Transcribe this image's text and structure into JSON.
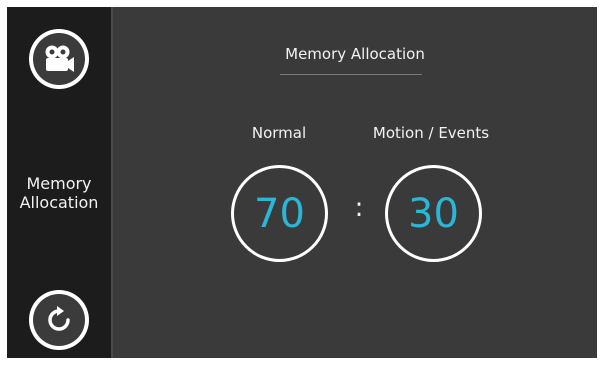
{
  "sidebar": {
    "camera_icon": "video-camera-icon",
    "reset_icon": "refresh-icon",
    "label_line1": "Memory",
    "label_line2": "Allocation"
  },
  "main": {
    "title": "Memory Allocation",
    "normal_label": "Normal",
    "events_label": "Motion / Events",
    "normal_value": "70",
    "events_value": "30",
    "separator": ":"
  },
  "colors": {
    "accent": "#2ab6d6",
    "sidebar_bg": "#1c1c1c",
    "main_bg": "#3a3a3a"
  }
}
